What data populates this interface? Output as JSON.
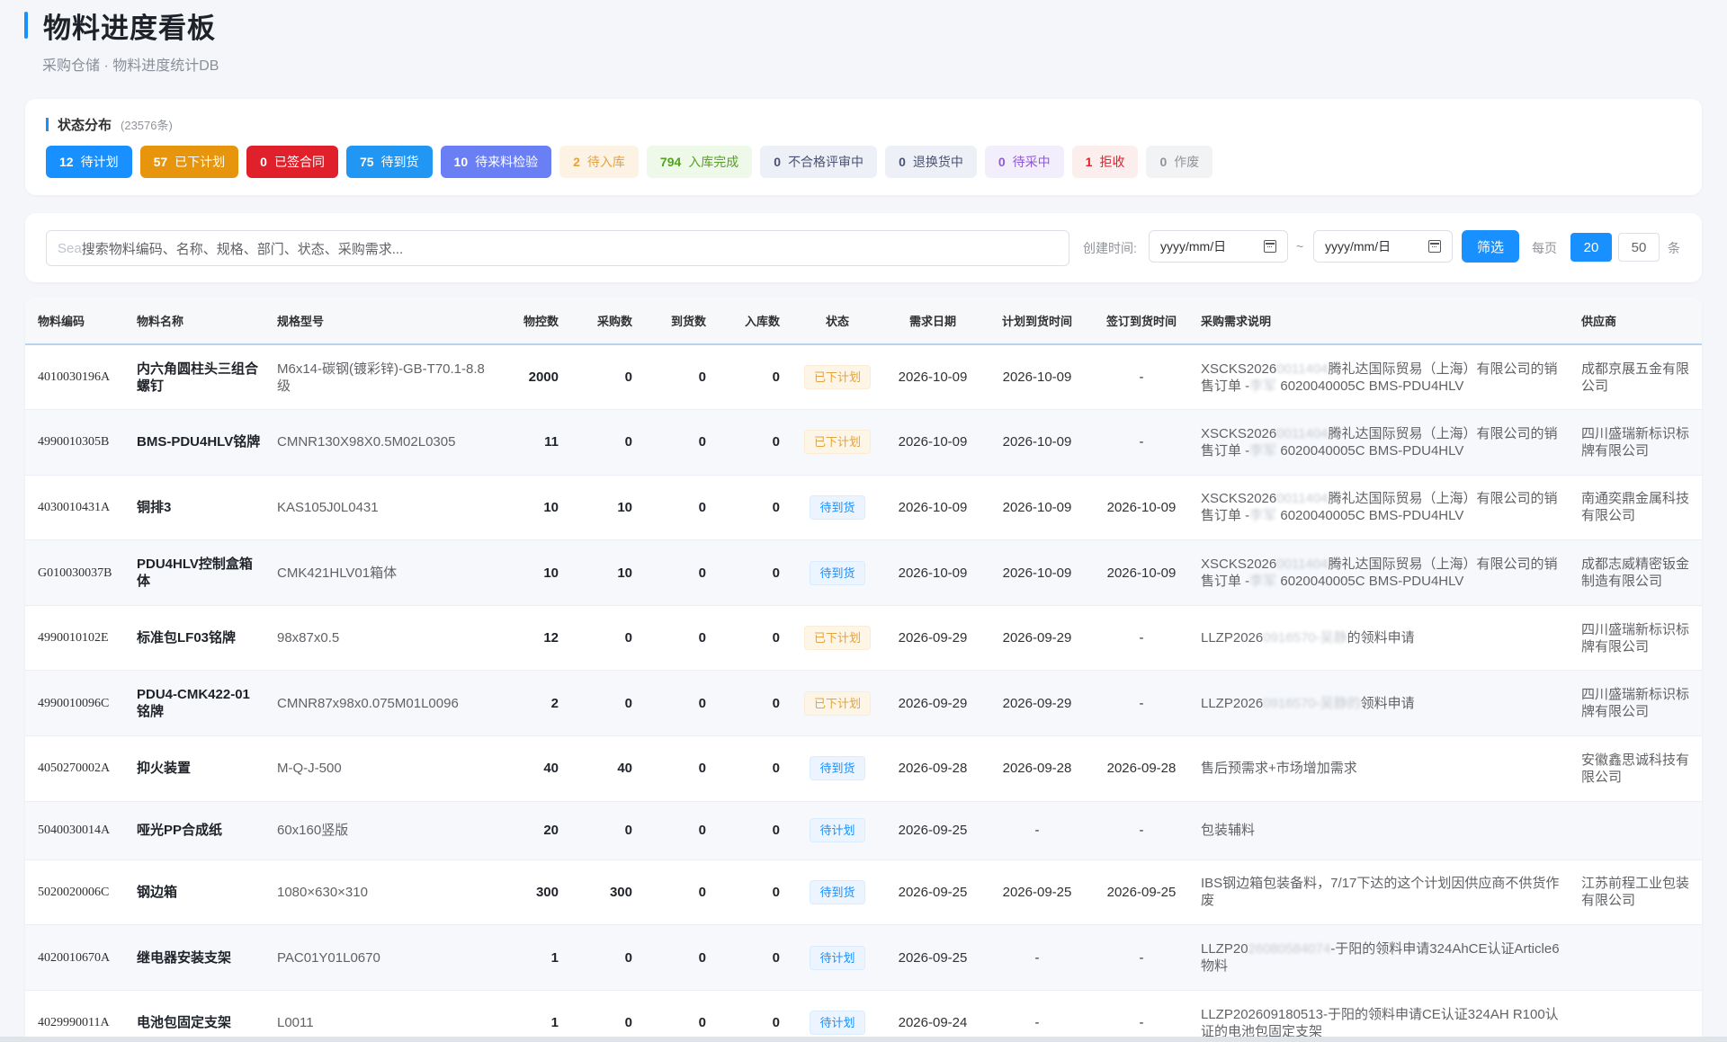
{
  "header": {
    "title": "物料进度看板",
    "subtitle": "采购仓储 · 物料进度统计DB"
  },
  "status": {
    "label": "状态分布",
    "total": "(23576条)",
    "chips": [
      {
        "count": "12",
        "label": "待计划",
        "bg": "#1890ff",
        "fg": "#ffffff",
        "style": "solid"
      },
      {
        "count": "57",
        "label": "已下计划",
        "bg": "#e6950c",
        "fg": "#ffffff",
        "style": "solid"
      },
      {
        "count": "0",
        "label": "已签合同",
        "bg": "#e0202a",
        "fg": "#ffffff",
        "style": "solid"
      },
      {
        "count": "75",
        "label": "待到货",
        "bg": "#2196f3",
        "fg": "#ffffff",
        "style": "solid"
      },
      {
        "count": "10",
        "label": "待来料检验",
        "bg": "#6b7ff5",
        "fg": "#ffffff",
        "style": "solid"
      },
      {
        "count": "2",
        "label": "待入库",
        "bg": "#fdf3e4",
        "fg": "#e6a23c",
        "style": "light"
      },
      {
        "count": "794",
        "label": "入库完成",
        "bg": "#eef9ea",
        "fg": "#52a31f",
        "style": "light"
      },
      {
        "count": "0",
        "label": "不合格评审中",
        "bg": "#eef0f7",
        "fg": "#4a5273",
        "style": "light"
      },
      {
        "count": "0",
        "label": "退换货中",
        "bg": "#eef0f7",
        "fg": "#4a5273",
        "style": "light"
      },
      {
        "count": "0",
        "label": "待采中",
        "bg": "#f3eefb",
        "fg": "#8e5bd6",
        "style": "light"
      },
      {
        "count": "1",
        "label": "拒收",
        "bg": "#fdeeee",
        "fg": "#e0202a",
        "style": "light"
      },
      {
        "count": "0",
        "label": "作废",
        "bg": "#f2f3f5",
        "fg": "#909399",
        "style": "light"
      }
    ]
  },
  "filter": {
    "search_placeholder_prefix": "Sea",
    "search_placeholder": "搜索物料编码、名称、规格、部门、状态、采购需求...",
    "created_label": "创建时间:",
    "date_from": "yyyy/mm/日",
    "date_sep": "~",
    "date_to": "yyyy/mm/日",
    "filter_button": "筛选",
    "per_page_label": "每页",
    "page_size_20": "20",
    "page_size_50": "50",
    "unit": "条"
  },
  "table": {
    "columns": [
      "物料编码",
      "物料名称",
      "规格型号",
      "物控数",
      "采购数",
      "到货数",
      "入库数",
      "状态",
      "需求日期",
      "计划到货时间",
      "签订到货时间",
      "采购需求说明",
      "供应商"
    ],
    "rows": [
      {
        "code": "4010030196A",
        "name": "内六角圆柱头三组合螺钉",
        "spec": "M6x14-碳钢(镀彩锌)-GB-T70.1-8.8级",
        "wk": "2000",
        "cg": "0",
        "dh": "0",
        "rk": "0",
        "status": "已下计划",
        "status_type": "plan",
        "need": "2026-10-09",
        "plan": "2026-10-09",
        "sign": "-",
        "req_a": "XSCKS2026",
        "req_b": "0011404",
        "req_c": "腾礼达国际贸易（上海）有限公司的销售订单 -",
        "req_d": "李军",
        "req_e": " 6020040005C BMS-PDU4HLV",
        "sup": "成都京展五金有限公司"
      },
      {
        "code": "4990010305B",
        "name": "BMS-PDU4HLV铭牌",
        "spec": "CMNR130X98X0.5M02L0305",
        "wk": "11",
        "cg": "0",
        "dh": "0",
        "rk": "0",
        "status": "已下计划",
        "status_type": "plan",
        "need": "2026-10-09",
        "plan": "2026-10-09",
        "sign": "-",
        "req_a": "XSCKS2026",
        "req_b": "0011404",
        "req_c": "腾礼达国际贸易（上海）有限公司的销售订单 -",
        "req_d": "李军",
        "req_e": " 6020040005C BMS-PDU4HLV",
        "sup": "四川盛瑞新标识标牌有限公司"
      },
      {
        "code": "4030010431A",
        "name": "铜排3",
        "spec": "KAS105J0L0431",
        "wk": "10",
        "cg": "10",
        "dh": "0",
        "rk": "0",
        "status": "待到货",
        "status_type": "arrive",
        "need": "2026-10-09",
        "plan": "2026-10-09",
        "sign": "2026-10-09",
        "req_a": "XSCKS2026",
        "req_b": "0011404",
        "req_c": "腾礼达国际贸易（上海）有限公司的销售订单 -",
        "req_d": "李军",
        "req_e": " 6020040005C BMS-PDU4HLV",
        "sup": "南通奕鼎金属科技有限公司"
      },
      {
        "code": "G010030037B",
        "name": "PDU4HLV控制盒箱体",
        "spec": "CMK421HLV01箱体",
        "wk": "10",
        "cg": "10",
        "dh": "0",
        "rk": "0",
        "status": "待到货",
        "status_type": "arrive",
        "need": "2026-10-09",
        "plan": "2026-10-09",
        "sign": "2026-10-09",
        "req_a": "XSCKS2026",
        "req_b": "0011404",
        "req_c": "腾礼达国际贸易（上海）有限公司的销售订单 -",
        "req_d": "李军",
        "req_e": " 6020040005C BMS-PDU4HLV",
        "sup": "成都志威精密钣金制造有限公司"
      },
      {
        "code": "4990010102E",
        "name": "标准包LF03铭牌",
        "spec": "98x87x0.5",
        "wk": "12",
        "cg": "0",
        "dh": "0",
        "rk": "0",
        "status": "已下计划",
        "status_type": "plan",
        "need": "2026-09-29",
        "plan": "2026-09-29",
        "sign": "-",
        "req_a": "LLZP2026",
        "req_b": "0916570-吴静",
        "req_c": "的领料申请",
        "req_d": "",
        "req_e": "",
        "sup": "四川盛瑞新标识标牌有限公司"
      },
      {
        "code": "4990010096C",
        "name": "PDU4-CMK422-01铭牌",
        "spec": "CMNR87x98x0.075M01L0096",
        "wk": "2",
        "cg": "0",
        "dh": "0",
        "rk": "0",
        "status": "已下计划",
        "status_type": "plan",
        "need": "2026-09-29",
        "plan": "2026-09-29",
        "sign": "-",
        "req_a": "LLZP2026",
        "req_b": "0916570-吴静的",
        "req_c": "领料申请",
        "req_d": "",
        "req_e": "",
        "sup": "四川盛瑞新标识标牌有限公司"
      },
      {
        "code": "4050270002A",
        "name": "抑火装置",
        "spec": "M-Q-J-500",
        "wk": "40",
        "cg": "40",
        "dh": "0",
        "rk": "0",
        "status": "待到货",
        "status_type": "arrive",
        "need": "2026-09-28",
        "plan": "2026-09-28",
        "sign": "2026-09-28",
        "req_a": "售后预需求+市场增加需求",
        "req_b": "",
        "req_c": "",
        "req_d": "",
        "req_e": "",
        "sup": "安徽鑫思诚科技有限公司"
      },
      {
        "code": "5040030014A",
        "name": "哑光PP合成纸",
        "spec": "60x160竖版",
        "wk": "20",
        "cg": "0",
        "dh": "0",
        "rk": "0",
        "status": "待计划",
        "status_type": "arrive",
        "need": "2026-09-25",
        "plan": "-",
        "sign": "-",
        "req_a": "包装辅料",
        "req_b": "",
        "req_c": "",
        "req_d": "",
        "req_e": "",
        "sup": ""
      },
      {
        "code": "5020020006C",
        "name": "钢边箱",
        "spec": "1080×630×310",
        "wk": "300",
        "cg": "300",
        "dh": "0",
        "rk": "0",
        "status": "待到货",
        "status_type": "arrive",
        "need": "2026-09-25",
        "plan": "2026-09-25",
        "sign": "2026-09-25",
        "req_a": "IBS钢边箱包装备料，7/17下达的这个计划因供应商不供货作废",
        "req_b": "",
        "req_c": "",
        "req_d": "",
        "req_e": "",
        "sup": "江苏前程工业包装有限公司"
      },
      {
        "code": "4020010670A",
        "name": "继电器安装支架",
        "spec": "PAC01Y01L0670",
        "wk": "1",
        "cg": "0",
        "dh": "0",
        "rk": "0",
        "status": "待计划",
        "status_type": "arrive",
        "need": "2026-09-25",
        "plan": "-",
        "sign": "-",
        "req_a": "LLZP20",
        "req_b": "26080584074",
        "req_c": "-于阳的领料申请324AhCE认证Article6物料",
        "req_d": "",
        "req_e": "",
        "sup": ""
      },
      {
        "code": "4029990011A",
        "name": "电池包固定支架",
        "spec": "L0011",
        "wk": "1",
        "cg": "0",
        "dh": "0",
        "rk": "0",
        "status": "待计划",
        "status_type": "arrive",
        "need": "2026-09-24",
        "plan": "-",
        "sign": "-",
        "req_a": "LLZP202609180513-于阳的领料申请CE认证324AH R100认证的电池包固定支架",
        "req_b": "",
        "req_c": "",
        "req_d": "",
        "req_e": "",
        "sup": ""
      }
    ]
  }
}
